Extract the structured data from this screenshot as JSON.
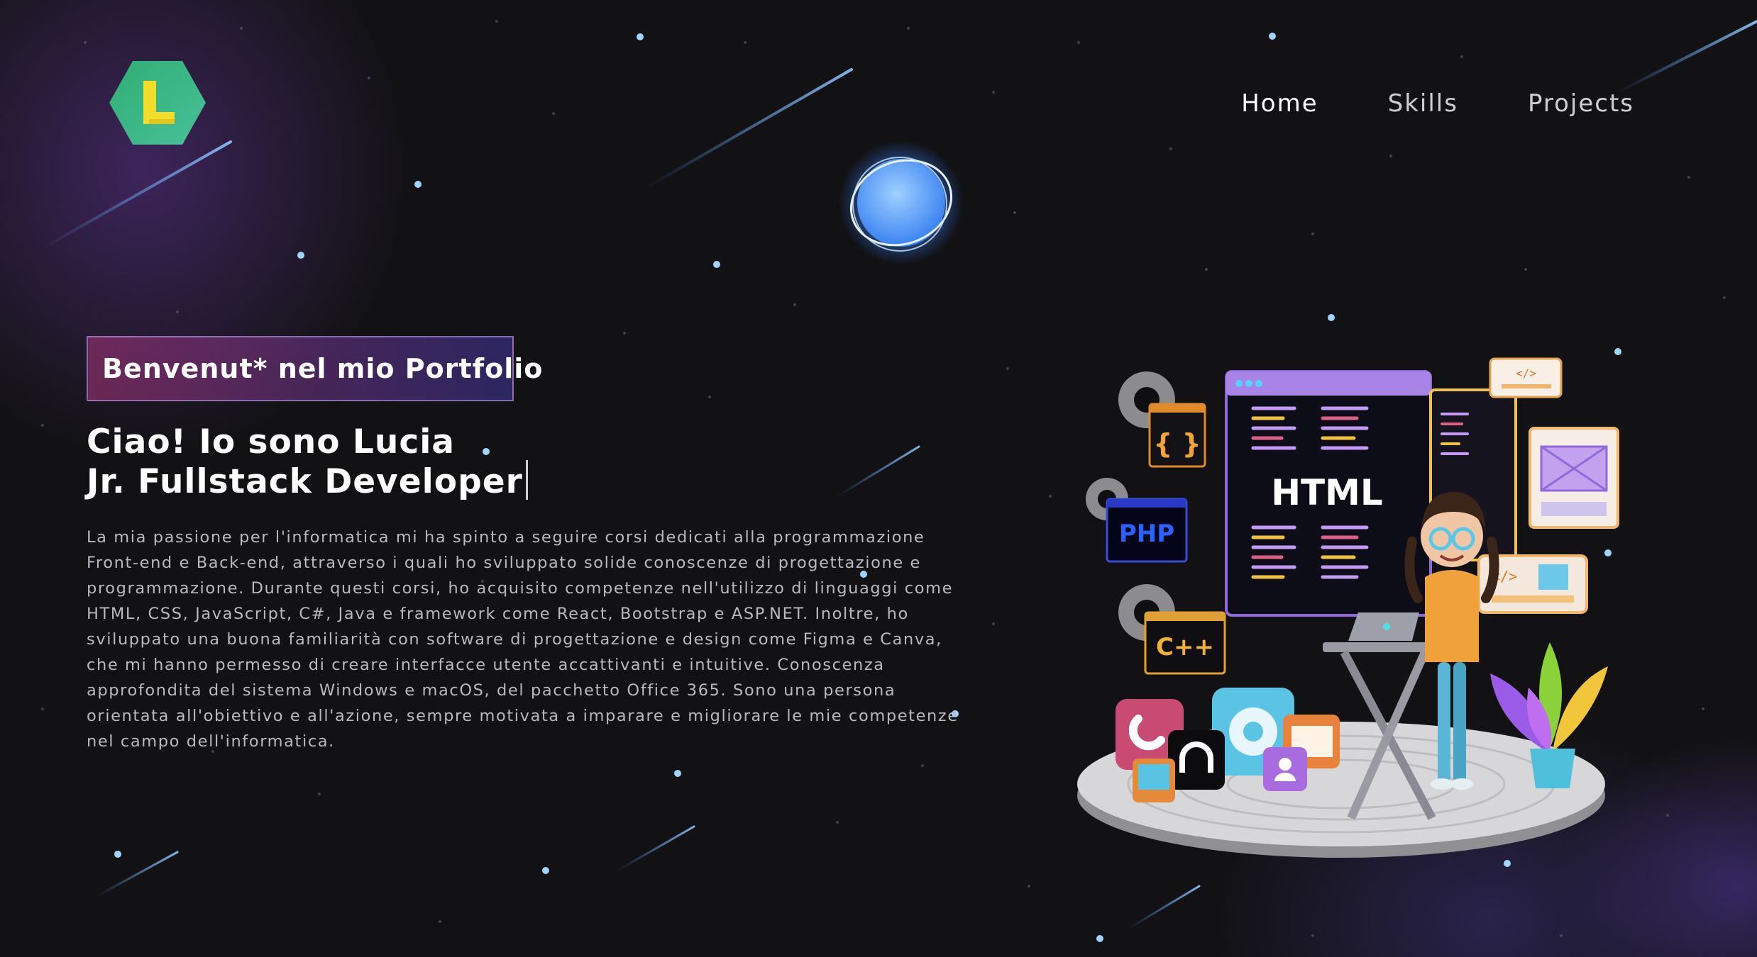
{
  "logo": {
    "letter": "L",
    "alt_icon": "hexagon-logo-icon"
  },
  "nav": {
    "items": [
      {
        "label": "Home"
      },
      {
        "label": "Skills"
      },
      {
        "label": "Projects"
      }
    ]
  },
  "hero": {
    "tagline": "Benvenut* nel mio Portfolio",
    "headline_line1": "Ciao! Io sono Lucia",
    "headline_line2": "Jr. Fullstack Developer",
    "bio": "La mia passione per l'informatica mi ha spinto a seguire corsi dedicati alla programmazione Front-end e Back-end, attraverso i quali ho sviluppato solide conoscenze di progettazione e programmazione. Durante questi corsi, ho acquisito competenze nell'utilizzo di linguaggi come HTML, CSS, JavaScript, C#, Java e framework come React, Bootstrap e ASP.NET. Inoltre, ho sviluppato una buona familiarità con software di progettazione e design come Figma e Canva, che mi hanno permesso di creare interfacce utente accattivanti e intuitive. Conoscenza approfondita del sistema Windows e macOS, del pacchetto Office 365. Sono una persona orientata all'obiettivo e all'azione, sempre motivata a imparare e migliorare le mie competenze nel campo dell'informatica."
  },
  "illustration": {
    "html_label": "HTML",
    "php_label": "PHP",
    "cpp_label": "C++",
    "braces_label": "{ }"
  },
  "colors": {
    "background": "#121214",
    "text_body": "#b8b8bf",
    "logo_green": "#3fb488",
    "logo_yellow": "#f2dc2c",
    "tagline_pink": "#aa367c",
    "tagline_blue": "#4a2fbd",
    "planet_blue": "#5aa7ff"
  }
}
